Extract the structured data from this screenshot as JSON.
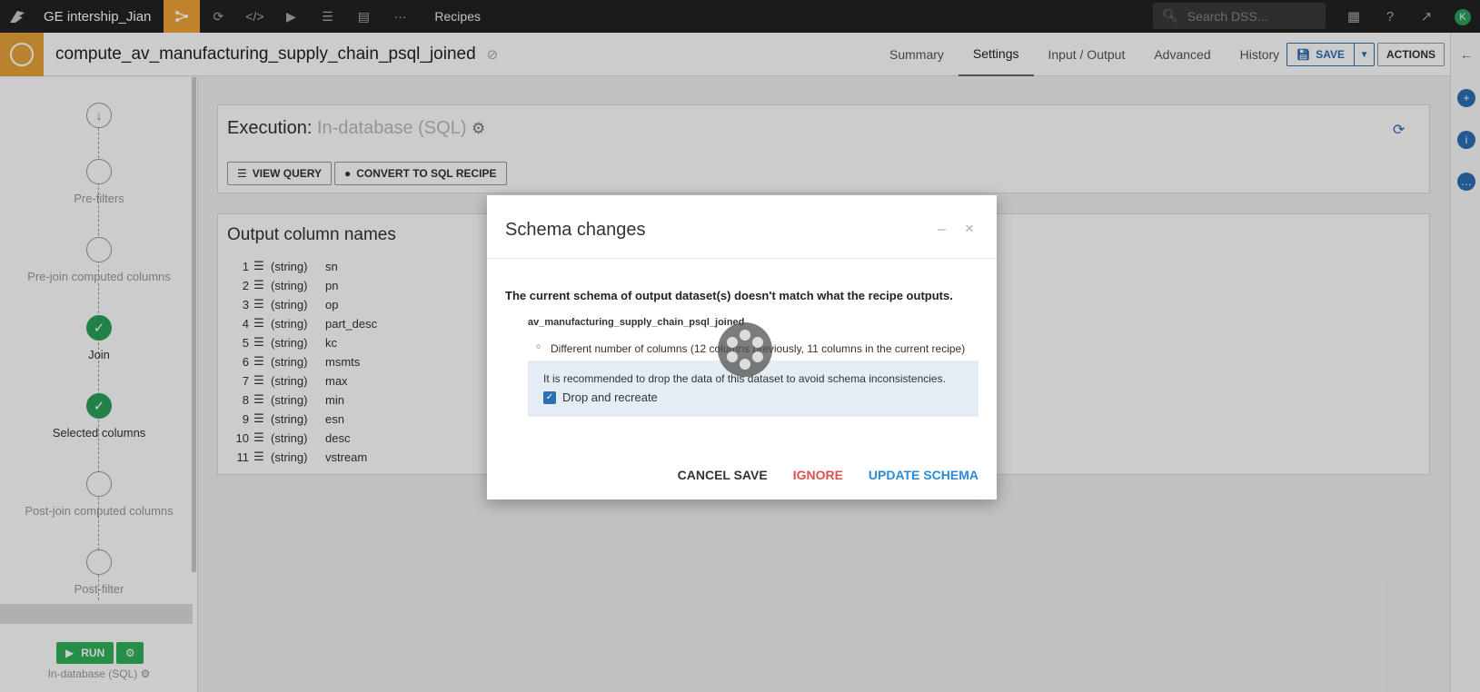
{
  "topnav": {
    "project_name": "GE intership_Jian",
    "section": "Recipes",
    "search_placeholder": "Search DSS...",
    "avatar_letter": "K"
  },
  "header": {
    "recipe_name": "compute_av_manufacturing_supply_chain_psql_joined",
    "tabs": [
      "Summary",
      "Settings",
      "Input / Output",
      "Advanced",
      "History"
    ],
    "active_tab": "Settings",
    "save_label": "SAVE",
    "actions_label": "ACTIONS"
  },
  "sidebar": {
    "steps": [
      {
        "label": "Pre-filters",
        "done": false
      },
      {
        "label": "Pre-join computed columns",
        "done": false
      },
      {
        "label": "Join",
        "done": true
      },
      {
        "label": "Selected columns",
        "done": true
      },
      {
        "label": "Post-join computed columns",
        "done": false
      },
      {
        "label": "Post-filter",
        "done": false
      }
    ],
    "run_label": "RUN",
    "engine_label": "In-database (SQL)"
  },
  "execution": {
    "title": "Execution:",
    "engine": "In-database (SQL)",
    "view_query_label": "VIEW QUERY",
    "convert_label": "CONVERT TO SQL RECIPE"
  },
  "output_columns": {
    "title": "Output column names",
    "columns": [
      {
        "num": "1",
        "type": "(string)",
        "name": "sn"
      },
      {
        "num": "2",
        "type": "(string)",
        "name": "pn"
      },
      {
        "num": "3",
        "type": "(string)",
        "name": "op"
      },
      {
        "num": "4",
        "type": "(string)",
        "name": "part_desc"
      },
      {
        "num": "5",
        "type": "(string)",
        "name": "kc"
      },
      {
        "num": "6",
        "type": "(string)",
        "name": "msmts"
      },
      {
        "num": "7",
        "type": "(string)",
        "name": "max"
      },
      {
        "num": "8",
        "type": "(string)",
        "name": "min"
      },
      {
        "num": "9",
        "type": "(string)",
        "name": "esn"
      },
      {
        "num": "10",
        "type": "(string)",
        "name": "desc"
      },
      {
        "num": "11",
        "type": "(string)",
        "name": "vstream"
      }
    ]
  },
  "modal": {
    "title": "Schema changes",
    "message": "The current schema of output dataset(s) doesn't match what the recipe outputs.",
    "dataset_name": "av_manufacturing_supply_chain_psql_joined",
    "difference": "Different number of columns (12 columns previously, 11 columns in the current recipe)",
    "recommendation": "It is recommended to drop the data of this dataset to avoid schema inconsistencies.",
    "checkbox_label": "Drop and recreate",
    "checkbox_checked": true,
    "cancel_label": "CANCEL SAVE",
    "ignore_label": "IGNORE",
    "update_label": "UPDATE SCHEMA"
  },
  "colors": {
    "accent_orange": "#e8a33a",
    "success_green": "#29a35a",
    "link_blue": "#2d6fb4",
    "danger_red": "#d9534f"
  }
}
